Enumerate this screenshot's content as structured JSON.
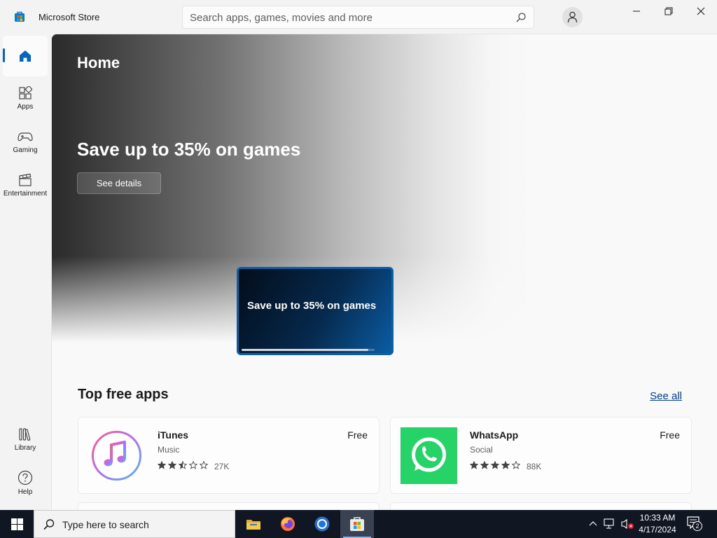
{
  "window": {
    "title": "Microsoft Store",
    "minimize_icon": "minimize-icon",
    "maximize_icon": "restore-icon",
    "close_icon": "close-icon"
  },
  "search": {
    "placeholder": "Search apps, games, movies and more",
    "value": "",
    "icon": "search-icon"
  },
  "nav": {
    "items": [
      {
        "label": "",
        "icon": "home-icon",
        "active": true
      },
      {
        "label": "Apps",
        "icon": "apps-icon"
      },
      {
        "label": "Gaming",
        "icon": "gamepad-icon"
      },
      {
        "label": "Entertainment",
        "icon": "clapperboard-icon"
      },
      {
        "label": "Library",
        "icon": "library-icon"
      },
      {
        "label": "Help",
        "icon": "help-icon"
      }
    ],
    "accent_color": "#0067c0"
  },
  "hero": {
    "page_title": "Home",
    "headline": "Save up to 35% on games",
    "button_label": "See details",
    "promo_card": {
      "text": "Save up to 35% on games",
      "progress": 0.95
    }
  },
  "top_free_apps": {
    "title": "Top free apps",
    "see_all_label": "See all",
    "apps": [
      {
        "name": "iTunes",
        "category": "Music",
        "price": "Free",
        "rating": 2.5,
        "rating_count": "27K",
        "icon": "itunes-icon"
      },
      {
        "name": "WhatsApp",
        "category": "Social",
        "price": "Free",
        "rating": 4,
        "rating_count": "88K",
        "icon": "whatsapp-icon"
      }
    ]
  },
  "taskbar": {
    "search_placeholder": "Type here to search",
    "apps": [
      "file-explorer-icon",
      "firefox-icon",
      "chrome-icon",
      "microsoft-store-icon"
    ],
    "time": "10:33 AM",
    "date": "4/17/2024",
    "notification_count": "2",
    "colors": {
      "background": "#101622"
    }
  }
}
